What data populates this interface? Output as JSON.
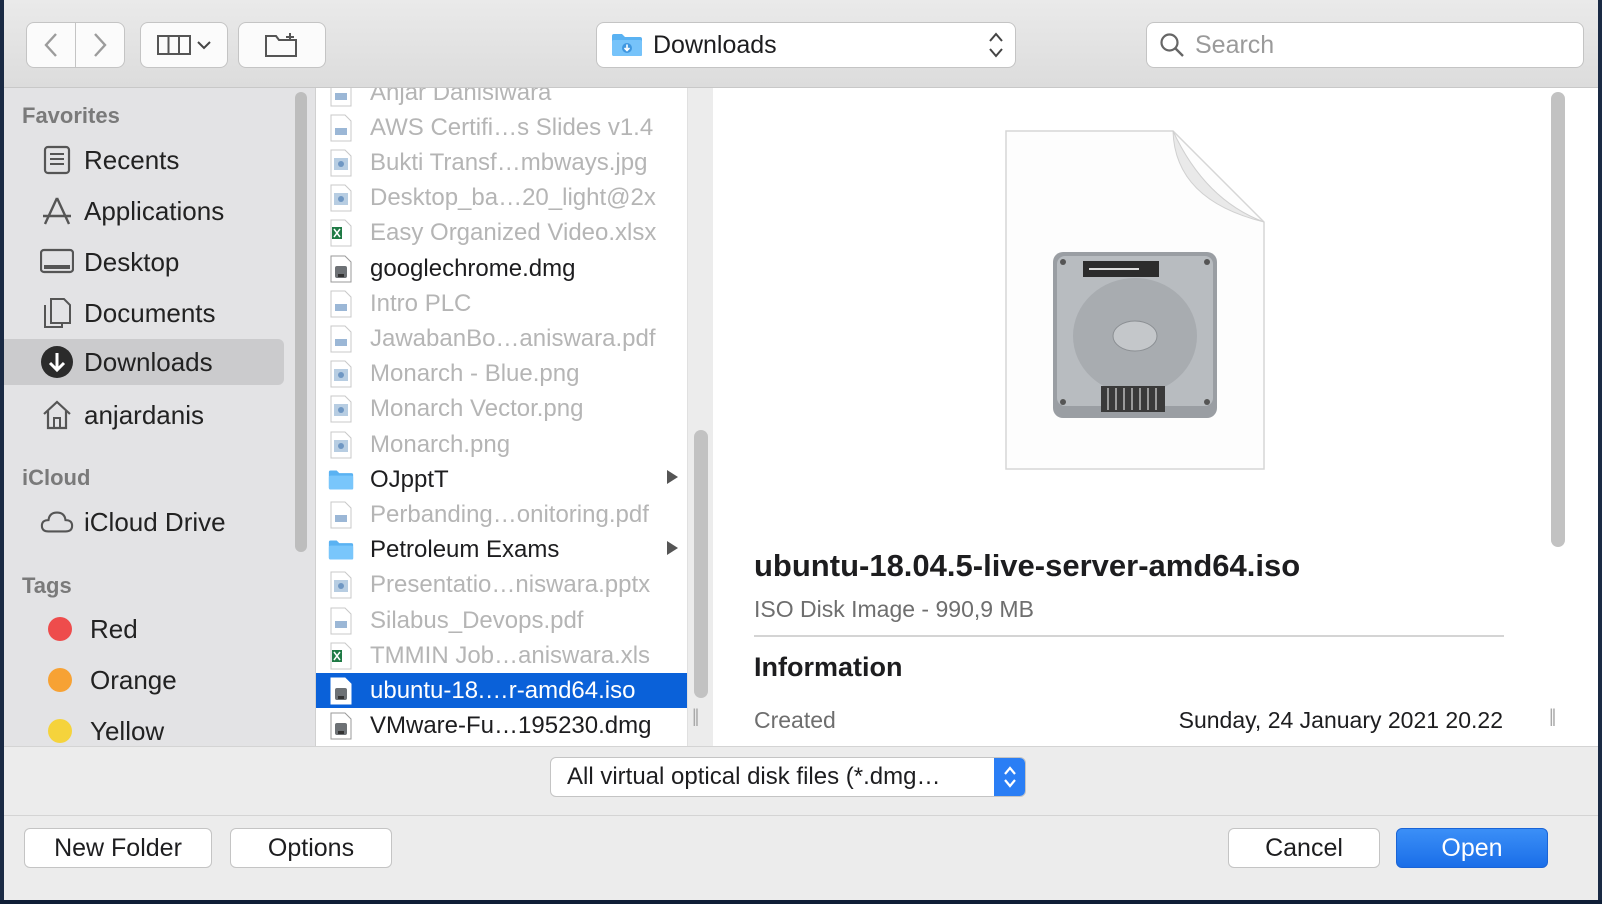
{
  "toolbar": {
    "back_icon": "chevron-left-icon",
    "forward_icon": "chevron-right-icon",
    "view_icon": "column-view-icon",
    "new_folder_icon": "new-folder-icon",
    "location": "Downloads",
    "search_placeholder": "Search"
  },
  "sidebar": {
    "favorites_title": "Favorites",
    "favorites": [
      {
        "label": "Recents",
        "icon": "recents-icon"
      },
      {
        "label": "Applications",
        "icon": "applications-icon"
      },
      {
        "label": "Desktop",
        "icon": "desktop-icon"
      },
      {
        "label": "Documents",
        "icon": "documents-icon"
      },
      {
        "label": "Downloads",
        "icon": "downloads-icon",
        "selected": true
      },
      {
        "label": "anjardanis",
        "icon": "home-icon"
      }
    ],
    "icloud_title": "iCloud",
    "icloud": [
      {
        "label": "iCloud Drive",
        "icon": "cloud-icon"
      }
    ],
    "tags_title": "Tags",
    "tags": [
      {
        "label": "Red",
        "color": "#ee4c4c"
      },
      {
        "label": "Orange",
        "color": "#f7a234"
      },
      {
        "label": "Yellow",
        "color": "#f5d33c"
      }
    ]
  },
  "files": [
    {
      "name": "Anjar Danisiwara",
      "type": "doc",
      "enabled": false
    },
    {
      "name": "AWS Certifi…s Slides v1.4",
      "type": "doc",
      "enabled": false
    },
    {
      "name": "Bukti Transf…mbways.jpg",
      "type": "image",
      "enabled": false
    },
    {
      "name": "Desktop_ba…20_light@2x",
      "type": "image",
      "enabled": false
    },
    {
      "name": "Easy Organized Video.xlsx",
      "type": "excel",
      "enabled": false
    },
    {
      "name": "googlechrome.dmg",
      "type": "disk",
      "enabled": true
    },
    {
      "name": "Intro PLC",
      "type": "doc",
      "enabled": false
    },
    {
      "name": "JawabanBo…aniswara.pdf",
      "type": "doc",
      "enabled": false
    },
    {
      "name": "Monarch - Blue.png",
      "type": "image",
      "enabled": false
    },
    {
      "name": "Monarch Vector.png",
      "type": "image",
      "enabled": false
    },
    {
      "name": "Monarch.png",
      "type": "image",
      "enabled": false
    },
    {
      "name": "OJpptT",
      "type": "folder",
      "enabled": true,
      "has_children": true
    },
    {
      "name": "Perbanding…onitoring.pdf",
      "type": "doc",
      "enabled": false
    },
    {
      "name": "Petroleum Exams",
      "type": "folder",
      "enabled": true,
      "has_children": true
    },
    {
      "name": "Presentatio…niswara.pptx",
      "type": "image",
      "enabled": false
    },
    {
      "name": "Silabus_Devops.pdf",
      "type": "doc",
      "enabled": false
    },
    {
      "name": "TMMIN Job…aniswara.xls",
      "type": "excel",
      "enabled": false
    },
    {
      "name": "ubuntu-18.…r-amd64.iso",
      "type": "disk",
      "enabled": true,
      "selected": true
    },
    {
      "name": "VMware-Fu…195230.dmg",
      "type": "disk",
      "enabled": true
    }
  ],
  "preview": {
    "icon": "hard-disk-document-icon",
    "name": "ubuntu-18.04.5-live-server-amd64.iso",
    "kind": "ISO Disk Image - 990,9 MB",
    "info_title": "Information",
    "created_label": "Created",
    "created_value": "Sunday, 24 January 2021 20.22"
  },
  "file_type_filter": "All virtual optical disk files (*.dmg…",
  "buttons": {
    "new_folder": "New Folder",
    "options": "Options",
    "cancel": "Cancel",
    "open": "Open"
  }
}
